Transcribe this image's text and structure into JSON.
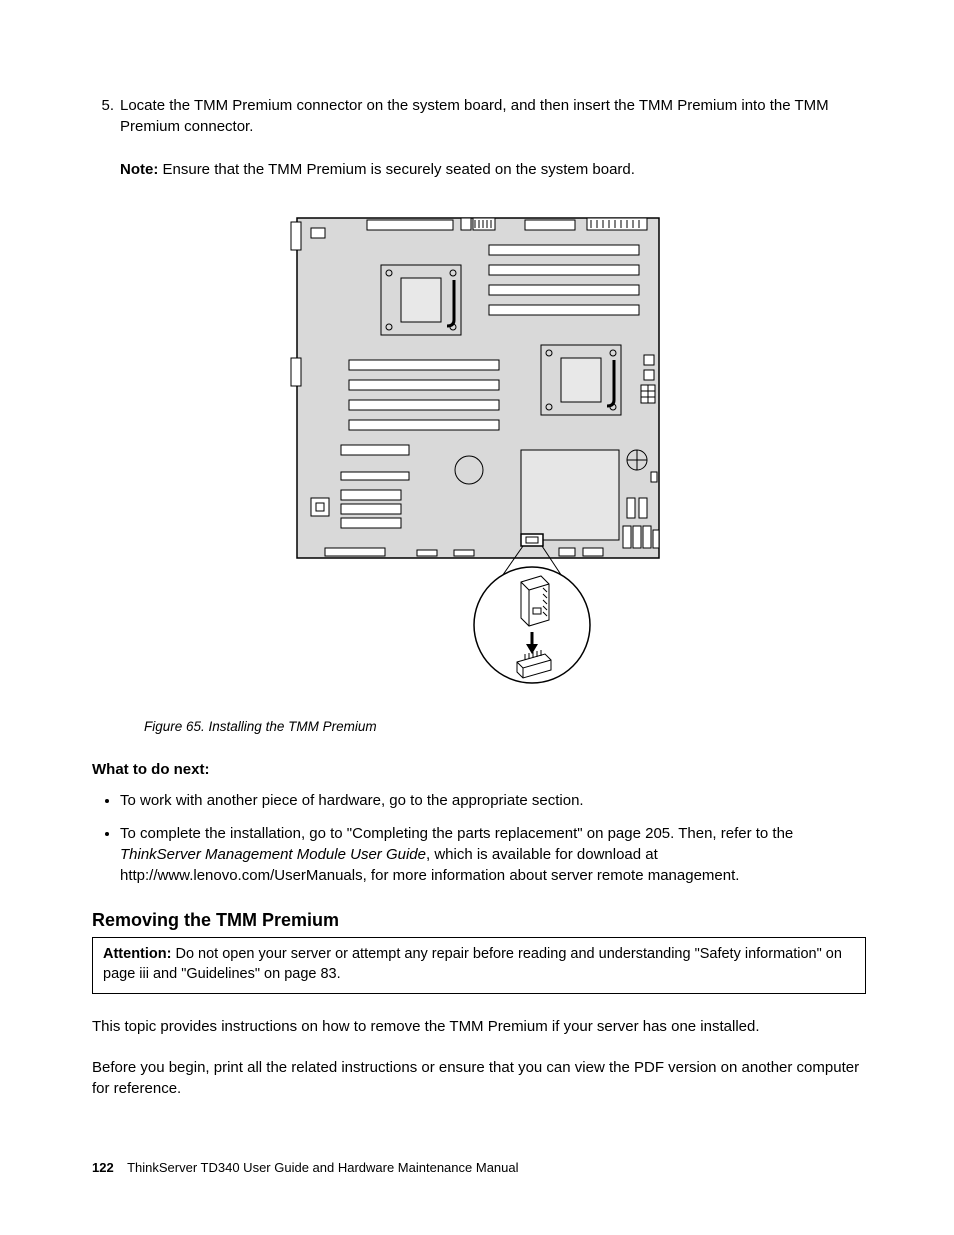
{
  "step": {
    "number": "5.",
    "text": "Locate the TMM Premium connector on the system board, and then insert the TMM Premium into the TMM Premium connector."
  },
  "note": {
    "label": "Note:",
    "text": "Ensure that the TMM Premium is securely seated on the system board."
  },
  "figure": {
    "caption": "Figure 65.  Installing the TMM Premium"
  },
  "what_next": {
    "heading": "What to do next:",
    "items": [
      {
        "text": "To work with another piece of hardware, go to the appropriate section."
      },
      {
        "text_a": "To complete the installation, go to \"Completing the parts replacement\" on page 205.  Then, refer to the ",
        "italic": "ThinkServer Management Module User Guide",
        "text_b": ", which is available for download at http://www.lenovo.com/UserManuals, for more information about server remote management."
      }
    ]
  },
  "section_title": "Removing the TMM Premium",
  "attention": {
    "label": "Attention:",
    "text": "Do not open your server or attempt any repair before reading and understanding \"Safety information\" on page iii and \"Guidelines\" on page 83."
  },
  "paragraphs": [
    "This topic provides instructions on how to remove the TMM Premium if your server has one installed.",
    "Before you begin, print all the related instructions or ensure that you can view the PDF version on another computer for reference."
  ],
  "footer": {
    "page_number": "122",
    "doc_title": "ThinkServer TD340 User Guide and Hardware Maintenance Manual"
  }
}
